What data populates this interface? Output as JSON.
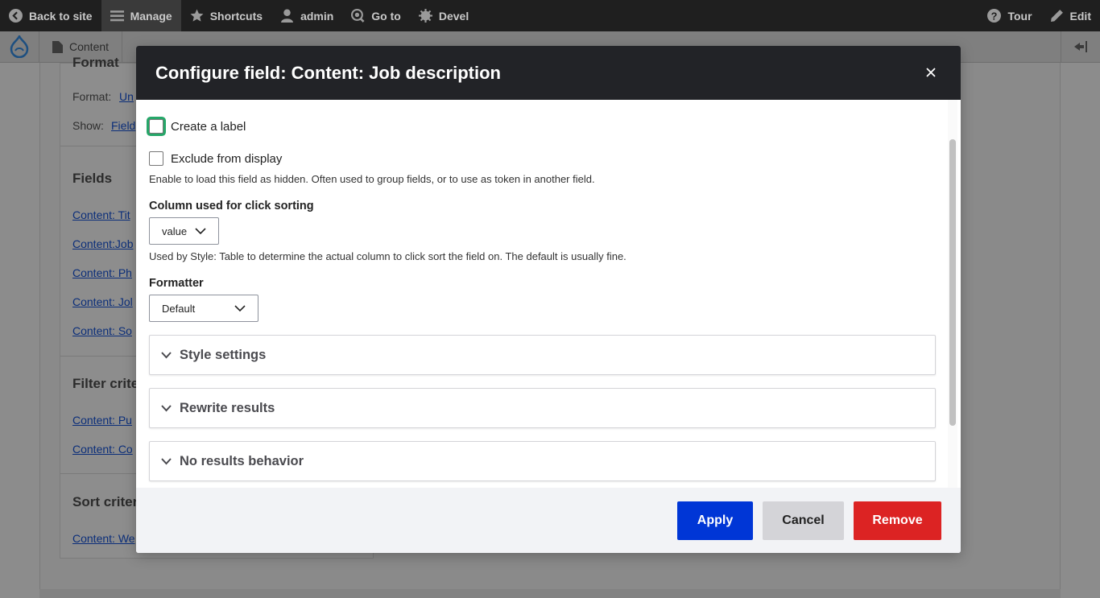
{
  "toolbar": {
    "back_label": "Back to site",
    "manage_label": "Manage",
    "shortcuts_label": "Shortcuts",
    "user_label": "admin",
    "goto_label": "Go to",
    "devel_label": "Devel",
    "tour_label": "Tour",
    "edit_label": "Edit"
  },
  "tray": {
    "content_label": "Content"
  },
  "background": {
    "format_heading": "Format",
    "format_label": "Format:",
    "format_link": "Un",
    "show_label": "Show:",
    "show_link": "Field",
    "fields_heading": "Fields",
    "field_links": [
      "Content: Tit",
      "Content:Job",
      "Content: Ph",
      "Content: Jol",
      "Content: So"
    ],
    "filter_heading": "Filter crite",
    "filter_links": [
      "Content: Pu",
      "Content: Co"
    ],
    "sort_heading": "Sort criter",
    "sort_links": [
      "Content: We"
    ]
  },
  "dialog": {
    "title": "Configure field: Content: Job description",
    "create_label": "Create a label",
    "exclude_label": "Exclude from display",
    "exclude_desc": "Enable to load this field as hidden. Often used to group fields, or to use as token in another field.",
    "sort_column_label": "Column used for click sorting",
    "sort_column_value": "value",
    "sort_column_desc": "Used by Style: Table to determine the actual column to click sort the field on. The default is usually fine.",
    "formatter_label": "Formatter",
    "formatter_value": "Default",
    "sections": [
      "Style settings",
      "Rewrite results",
      "No results behavior"
    ],
    "apply_label": "Apply",
    "cancel_label": "Cancel",
    "remove_label": "Remove"
  }
}
